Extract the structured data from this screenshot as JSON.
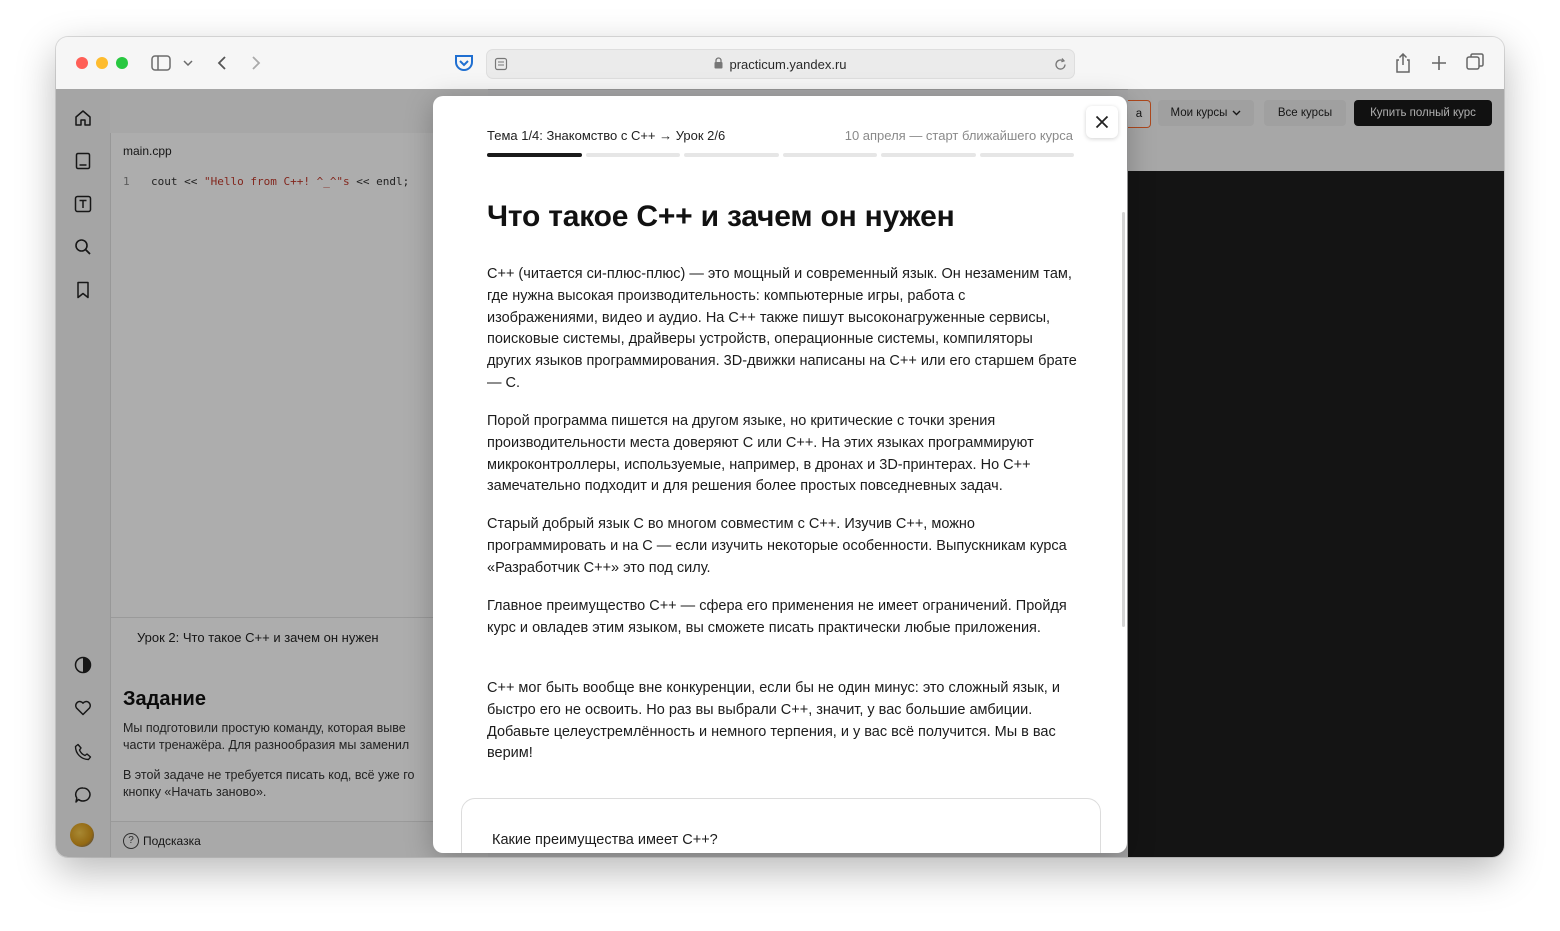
{
  "browser": {
    "url": "practicum.yandex.ru"
  },
  "page": {
    "editor": {
      "file_tab": "main.cpp",
      "line_number": "1",
      "code_prefix": "cout << ",
      "code_string": "\"Hello from C++! ^_^\"s",
      "code_suffix": " << endl;"
    },
    "lesson_title": "Урок 2: Что такое C++ и зачем он нужен",
    "task": {
      "heading": "Задание",
      "line1": "Мы подготовили простую команду, которая выве",
      "line2": "части тренажёра. Для разнообразия мы заменил",
      "line3": "В этой задаче не требуется писать код, всё уже го",
      "line4": "кнопку «Начать заново»."
    },
    "hint_label": "Подсказка",
    "nav": {
      "partial_button": "а",
      "my_courses": "Мои курсы",
      "all_courses": "Все курсы",
      "buy_full": "Купить полный курс"
    }
  },
  "modal": {
    "breadcrumb": "Тема 1/4: Знакомство с C++ → Урок 2/6",
    "next_start": "10 апреля — старт ближайшего курса",
    "progress": {
      "total_segments": 6,
      "active_segment": 1
    },
    "title": "Что такое C++ и зачем он нужен",
    "paragraphs": [
      "C++ (читается си-плюс-плюс) — это мощный и современный язык. Он незаменим там, где нужна высокая производительность: компьютерные игры, работа с изображениями, видео и аудио. На C++ также пишут высоконагруженные сервисы, поисковые системы, драйверы устройств, операционные системы, компиляторы других языков программирования. 3D-движки написаны на C++ или его старшем брате — C.",
      "Порой программа пишется на другом языке, но критические с точки зрения производительности места доверяют C или C++. На этих языках программируют микроконтроллеры, используемые, например, в дронах и 3D-принтерах. Но C++ замечательно подходит и для решения более простых повседневных задач.",
      "Старый добрый язык C во многом совместим с C++. Изучив C++, можно программировать и на C — если изучить некоторые особенности. Выпускникам курса «Разработчик C++» это под силу.",
      "Главное преимущество C++ — сфера его применения не имеет ограничений. Пройдя курс и овладев этим языком, вы сможете писать практически любые приложения.",
      "C++ мог быть вообще вне конкуренции, если бы не один минус: это сложный язык, и быстро его не освоить. Но раз вы выбрали C++, значит, у вас большие амбиции. Добавьте целеустремлённость и немного терпения, и у вас всё получится. Мы в вас верим!"
    ],
    "quiz_question": "Какие преимущества имеет C++?"
  },
  "colors": {
    "accent_orange": "#ff6a2b",
    "dark_button": "#1a1a1a",
    "progress_active": "#1a1a1a",
    "progress_inactive": "#e6e6e6",
    "dim_overlay": "rgba(0,0,0,0.32)"
  },
  "icons": {
    "toolbar": [
      "sidebar-icon",
      "chevron-down-icon",
      "back-icon",
      "forward-icon",
      "pocket-icon",
      "reader-icon",
      "lock-icon",
      "reload-icon",
      "share-icon",
      "new-tab-icon",
      "tabs-overview-icon"
    ],
    "leftbar": [
      "home-icon",
      "book-icon",
      "text-icon",
      "search-icon",
      "bookmark-icon",
      "contrast-icon",
      "heart-icon",
      "phone-icon",
      "chat-icon",
      "avatar"
    ],
    "modal": [
      "close-icon"
    ]
  }
}
